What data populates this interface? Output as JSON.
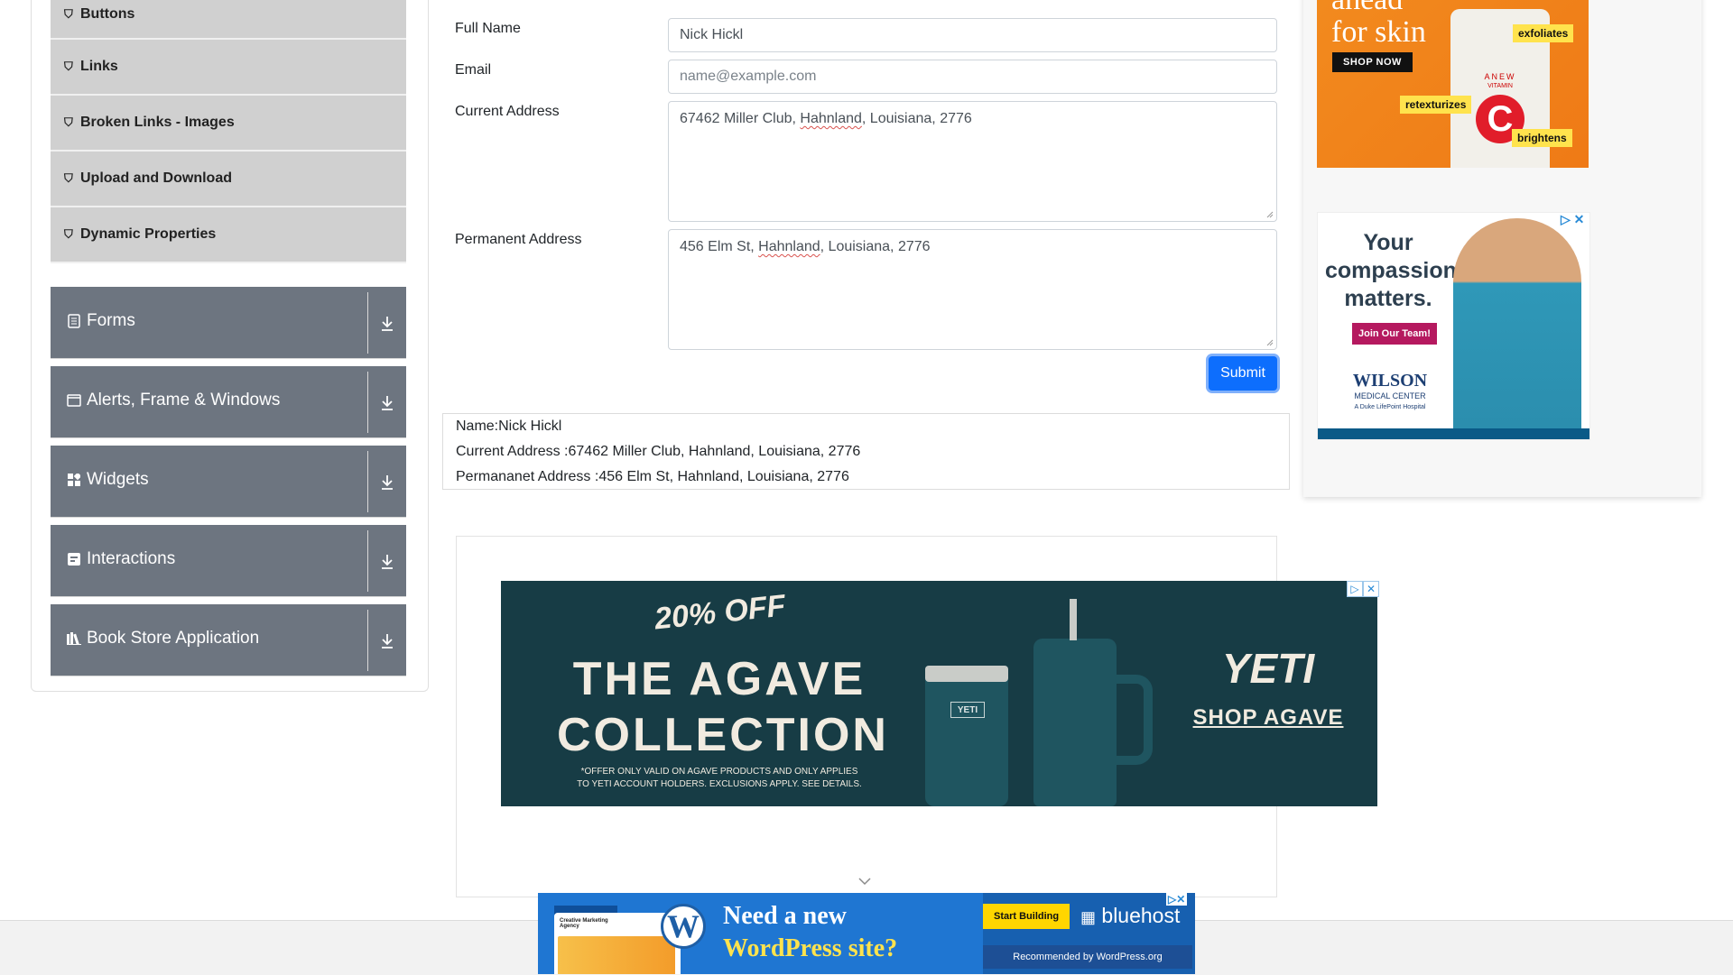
{
  "sidebar": {
    "element_items": [
      {
        "label": "Buttons",
        "icon": "element-icon"
      },
      {
        "label": "Links",
        "icon": "element-icon"
      },
      {
        "label": "Broken Links - Images",
        "icon": "element-icon"
      },
      {
        "label": "Upload and Download",
        "icon": "element-icon"
      },
      {
        "label": "Dynamic Properties",
        "icon": "element-icon"
      }
    ],
    "groups": [
      {
        "label": "Forms",
        "icon": "clipboard-icon"
      },
      {
        "label": "Alerts, Frame & Windows",
        "icon": "window-icon"
      },
      {
        "label": "Widgets",
        "icon": "grid-icon"
      },
      {
        "label": "Interactions",
        "icon": "interaction-icon"
      },
      {
        "label": "Book Store Application",
        "icon": "books-icon"
      }
    ]
  },
  "form": {
    "full_name_label": "Full Name",
    "full_name_value": "Nick Hickl",
    "email_label": "Email",
    "email_placeholder": "name@example.com",
    "current_address_label": "Current Address",
    "current_address": {
      "pre": "67462 Miller Club, ",
      "flagged": "Hahnland",
      "post": ", Louisiana, 2776"
    },
    "permanent_address_label": "Permanent Address",
    "permanent_address": {
      "pre": "456 Elm St, ",
      "flagged": "Hahnland",
      "post": ", Louisiana, 2776"
    },
    "submit_label": "Submit"
  },
  "output": {
    "name_line": "Name:Nick Hickl",
    "current_line": "Current Address :67462 Miller Club, Hahnland, Louisiana, 2776",
    "permanent_line": "Permananet Address :456 Elm St, Hahnland, Louisiana, 2776"
  },
  "ads": {
    "skin": {
      "headline_1": "ahead",
      "headline_2": "for skin",
      "cta": "SHOP NOW",
      "tag_1": "exfoliates",
      "tag_2": "retexturizes",
      "tag_3": "brightens",
      "brand": "ANEW",
      "sub": "VITAMIN",
      "mark": "C"
    },
    "nurse": {
      "line_1": "Your",
      "line_2": "compassion",
      "line_3": "matters.",
      "cta": "Join Our Team!",
      "org_1": "WILSON",
      "org_2": "MEDICAL CENTER",
      "org_3": "A Duke LifePoint Hospital"
    },
    "yeti": {
      "discount": "20% OFF",
      "title_1": "THE AGAVE",
      "title_2": "COLLECTION",
      "fine_1": "*OFFER ONLY VALID ON AGAVE PRODUCTS AND ONLY APPLIES",
      "fine_2": "TO YETI ACCOUNT HOLDERS. EXCLUSIONS APPLY. SEE DETAILS.",
      "brand": "YETI",
      "cta": "SHOP AGAVE",
      "cup_mark": "YETI"
    },
    "wordpress": {
      "line_1": "Need a new",
      "line_2": "WordPress site?",
      "cta": "Start Building",
      "host": "bluehost",
      "recommended": "Recommended by WordPress.org",
      "shot_title": "Creative Marketing Agency"
    },
    "colors": {
      "accent": "#0d6efd",
      "sidebar_group": "#6d7580",
      "sidebar_item": "#d0d0d0"
    }
  }
}
